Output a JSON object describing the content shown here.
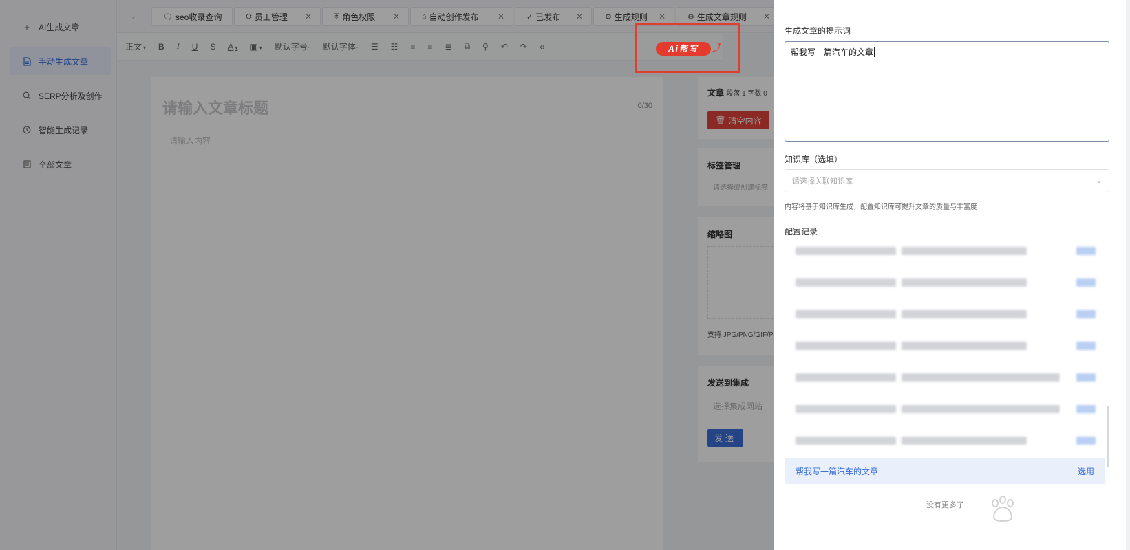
{
  "sidebar": {
    "items": [
      {
        "icon": "plus-icon",
        "label": "AI生成文章"
      },
      {
        "icon": "document-icon",
        "label": "手动生成文章"
      },
      {
        "icon": "search-icon",
        "label": "SERP分析及创作"
      },
      {
        "icon": "history-icon",
        "label": "智能生成记录"
      },
      {
        "icon": "list-icon",
        "label": "全部文章"
      }
    ]
  },
  "tabs": [
    {
      "label": "seo收录查询",
      "icon": "chat-search-icon"
    },
    {
      "label": "员工管理",
      "icon": "team-icon",
      "closable": true
    },
    {
      "label": "角色权限",
      "icon": "shield-icon",
      "closable": true
    },
    {
      "label": "自动创作发布",
      "icon": "home-icon",
      "closable": true
    },
    {
      "label": "已发布",
      "icon": "check-circle-icon",
      "closable": true
    },
    {
      "label": "生成规则",
      "icon": "gear-icon",
      "closable": true
    },
    {
      "label": "生成文章规则",
      "icon": "gear-icon",
      "closable": true
    }
  ],
  "toolbar": {
    "paragraph": "正文",
    "font_size": "默认字号",
    "font_family": "默认字体",
    "ai_button": "Ai帮写"
  },
  "editor": {
    "title_placeholder": "请输入文章标题",
    "title_count": "0/30",
    "content_placeholder": "请输入内容"
  },
  "settings": {
    "article_label": "文章",
    "article_stats": "段落 1 字数 0",
    "clear_button": "清空内容",
    "tags_label": "标签管理",
    "tags_placeholder": "请选择或创建标签",
    "thumb_label": "缩略图",
    "thumb_hint": "支持 JPG/PNG/GIF/P",
    "send_label": "发送到集成",
    "send_placeholder": "选择集成网站",
    "send_button": "发送"
  },
  "drawer": {
    "prompt_label": "生成文章的提示词",
    "prompt_value": "帮我写一篇汽车的文章",
    "kb_label": "知识库（选填）",
    "kb_placeholder": "请选择关联知识库",
    "kb_hint": "内容将基于知识库生成，配置知识库可提升文章的质量与丰富度",
    "records_label": "配置记录",
    "active_record": "帮我写一篇汽车的文章",
    "use_button": "选用",
    "no_more": "没有更多了"
  },
  "colors": {
    "accent": "#3b6fd8",
    "danger": "#e53b2f"
  }
}
